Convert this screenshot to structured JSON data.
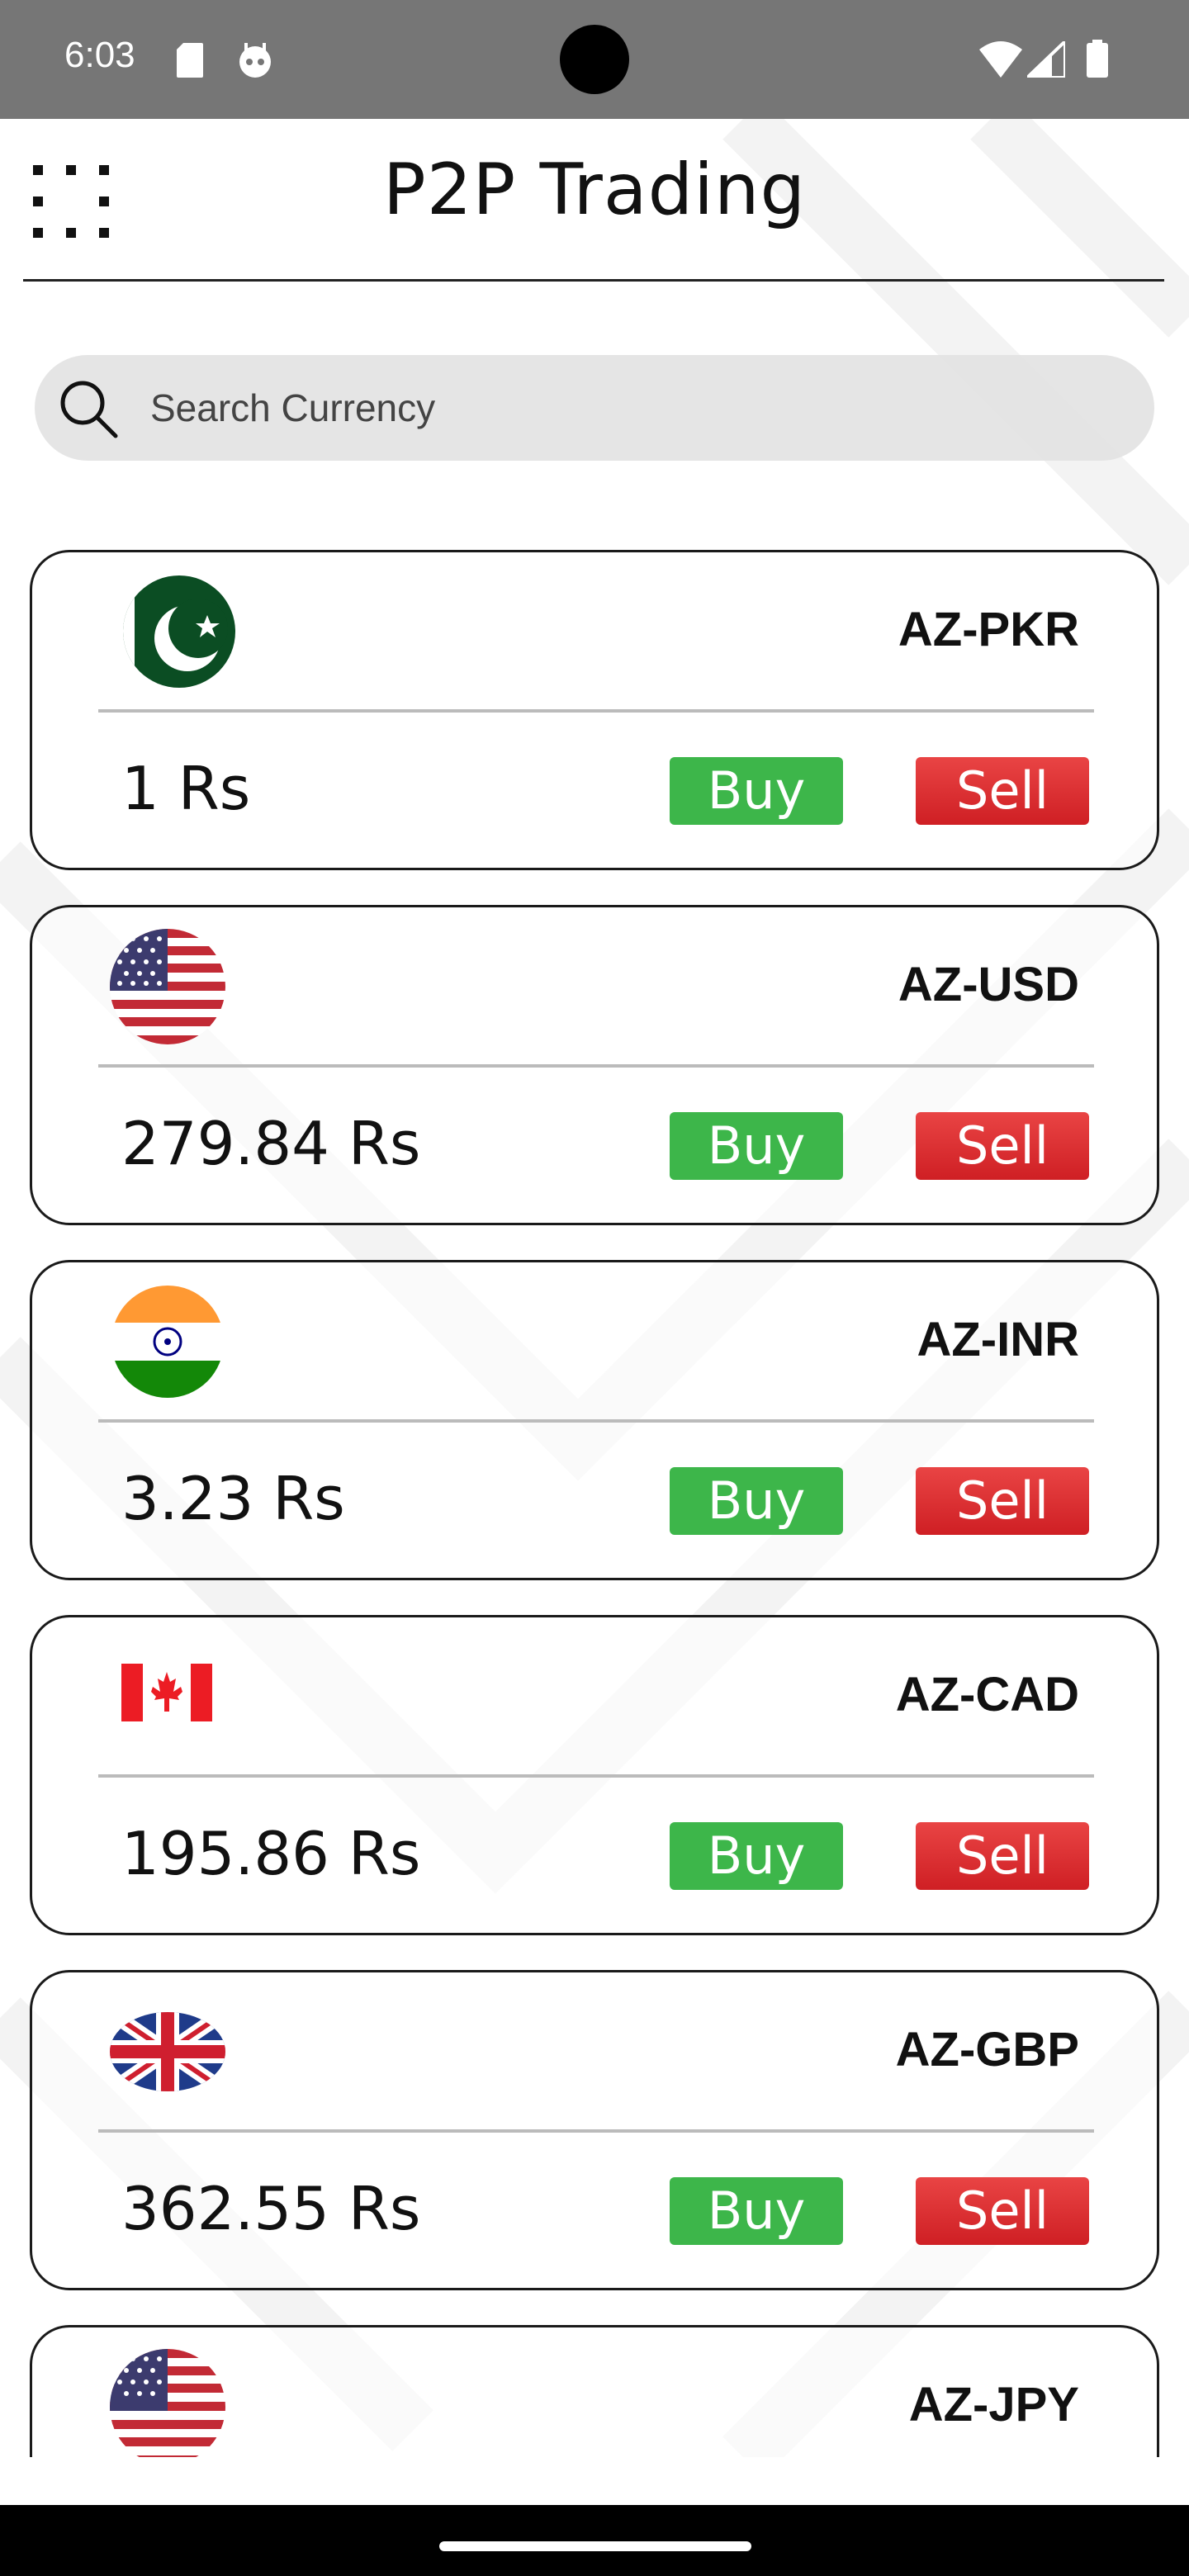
{
  "status_bar": {
    "time": "6:03"
  },
  "header": {
    "title": "P2P Trading"
  },
  "search": {
    "placeholder": "Search Currency",
    "value": ""
  },
  "currencies": [
    {
      "code": "AZ-PKR",
      "price": "1 Rs",
      "flag": "pakistan-flag",
      "buy_label": "Buy",
      "sell_label": "Sell"
    },
    {
      "code": "AZ-USD",
      "price": "279.84 Rs",
      "flag": "usa-flag",
      "buy_label": "Buy",
      "sell_label": "Sell"
    },
    {
      "code": "AZ-INR",
      "price": "3.23 Rs",
      "flag": "india-flag",
      "buy_label": "Buy",
      "sell_label": "Sell"
    },
    {
      "code": "AZ-CAD",
      "price": "195.86 Rs",
      "flag": "canada-flag",
      "buy_label": "Buy",
      "sell_label": "Sell"
    },
    {
      "code": "AZ-GBP",
      "price": "362.55 Rs",
      "flag": "uk-flag",
      "buy_label": "Buy",
      "sell_label": "Sell"
    },
    {
      "code": "AZ-JPY",
      "price": "",
      "flag": "usa-flag",
      "buy_label": "",
      "sell_label": ""
    }
  ],
  "colors": {
    "buy": "#3db64a",
    "sell": "#d62a2f",
    "status_bar": "#767676"
  }
}
